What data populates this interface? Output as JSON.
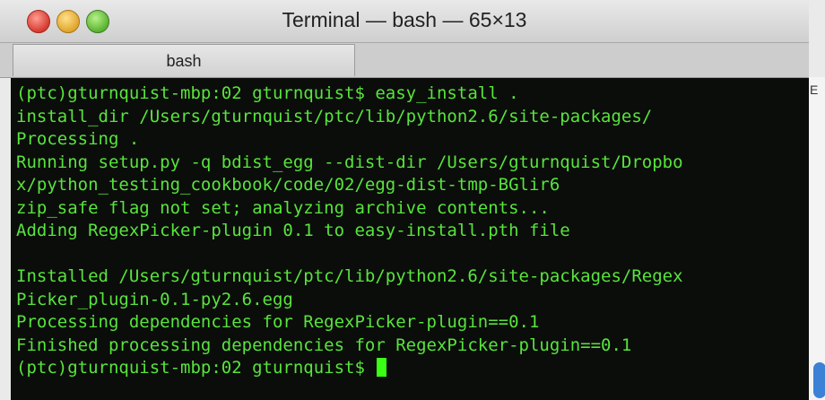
{
  "window": {
    "title": "Terminal — bash — 65×13",
    "tab_label": "bash"
  },
  "terminal": {
    "lines": [
      "(ptc)gturnquist-mbp:02 gturnquist$ easy_install .",
      "install_dir /Users/gturnquist/ptc/lib/python2.6/site-packages/",
      "Processing .",
      "Running setup.py -q bdist_egg --dist-dir /Users/gturnquist/Dropbo",
      "x/python_testing_cookbook/code/02/egg-dist-tmp-BGlir6",
      "zip_safe flag not set; analyzing archive contents...",
      "Adding RegexPicker-plugin 0.1 to easy-install.pth file",
      "",
      "Installed /Users/gturnquist/ptc/lib/python2.6/site-packages/Regex",
      "Picker_plugin-0.1-py2.6.egg",
      "Processing dependencies for RegexPicker-plugin==0.1",
      "Finished processing dependencies for RegexPicker-plugin==0.1"
    ],
    "prompt": "(ptc)gturnquist-mbp:02 gturnquist$ "
  },
  "background_window": {
    "edge_label": "E"
  },
  "colors": {
    "terminal_bg": "#0b0d0b",
    "terminal_text": "#58e43c",
    "cursor": "#39ff14"
  }
}
